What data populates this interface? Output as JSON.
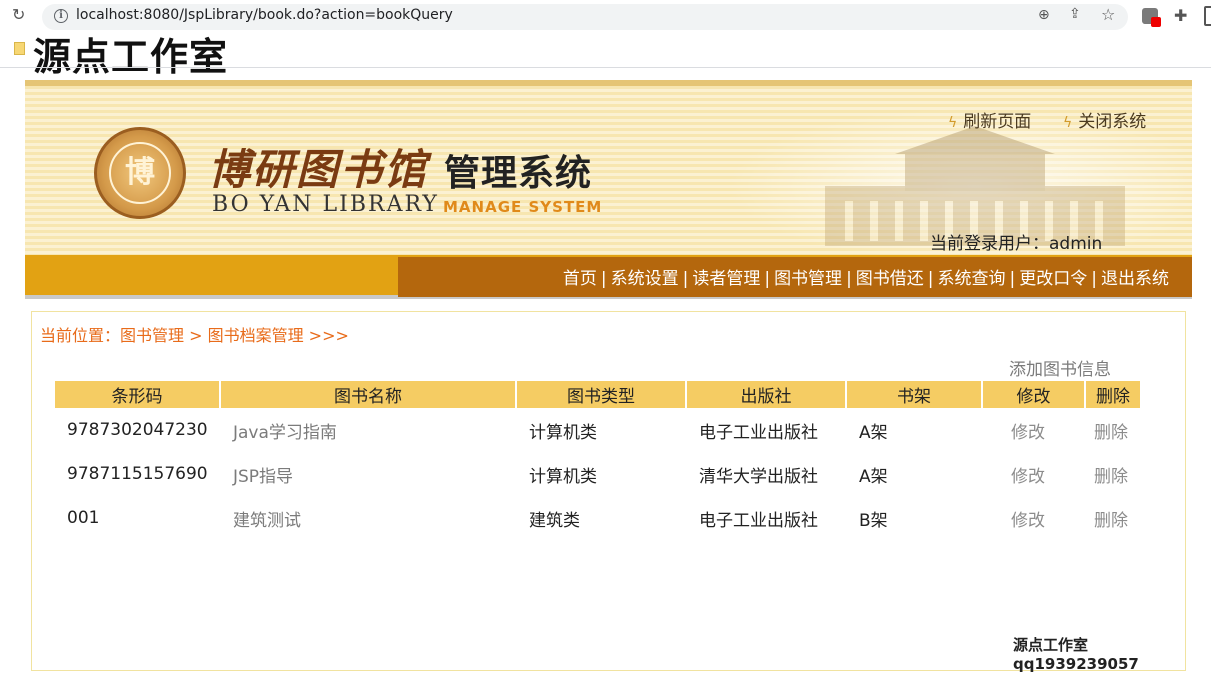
{
  "browser": {
    "url": "localhost:8080/JspLibrary/book.do?action=bookQuery"
  },
  "watermark_top": "源点工作室",
  "banner": {
    "logo_char": "博",
    "title_cn": "博研图书馆",
    "title_sys": "管理系统",
    "title_en": "BO YAN LIBRARY",
    "title_manage": "MANAGE SYSTEM",
    "refresh_label": "刷新页面",
    "close_label": "关闭系统",
    "login_user": "当前登录用户：admin"
  },
  "menu": {
    "items": [
      "首页",
      "系统设置",
      "读者管理",
      "图书管理",
      "图书借还",
      "系统查询",
      "更改口令",
      "退出系统"
    ]
  },
  "content": {
    "breadcrumb": "当前位置：图书管理 > 图书档案管理 >>>",
    "add_book": "添加图书信息",
    "columns": [
      "条形码",
      "图书名称",
      "图书类型",
      "出版社",
      "书架",
      "修改",
      "删除"
    ],
    "rows": [
      {
        "barcode": "9787302047230",
        "name": "Java学习指南",
        "type": "计算机类",
        "publisher": "电子工业出版社",
        "shelf": "A架",
        "edit": "修改",
        "delete": "删除"
      },
      {
        "barcode": "9787115157690",
        "name": "JSP指导",
        "type": "计算机类",
        "publisher": "清华大学出版社",
        "shelf": "A架",
        "edit": "修改",
        "delete": "删除"
      },
      {
        "barcode": "001",
        "name": "建筑测试",
        "type": "建筑类",
        "publisher": "电子工业出版社",
        "shelf": "B架",
        "edit": "修改",
        "delete": "删除"
      }
    ]
  },
  "footer_watermark": "源点工作室qq1939239057"
}
